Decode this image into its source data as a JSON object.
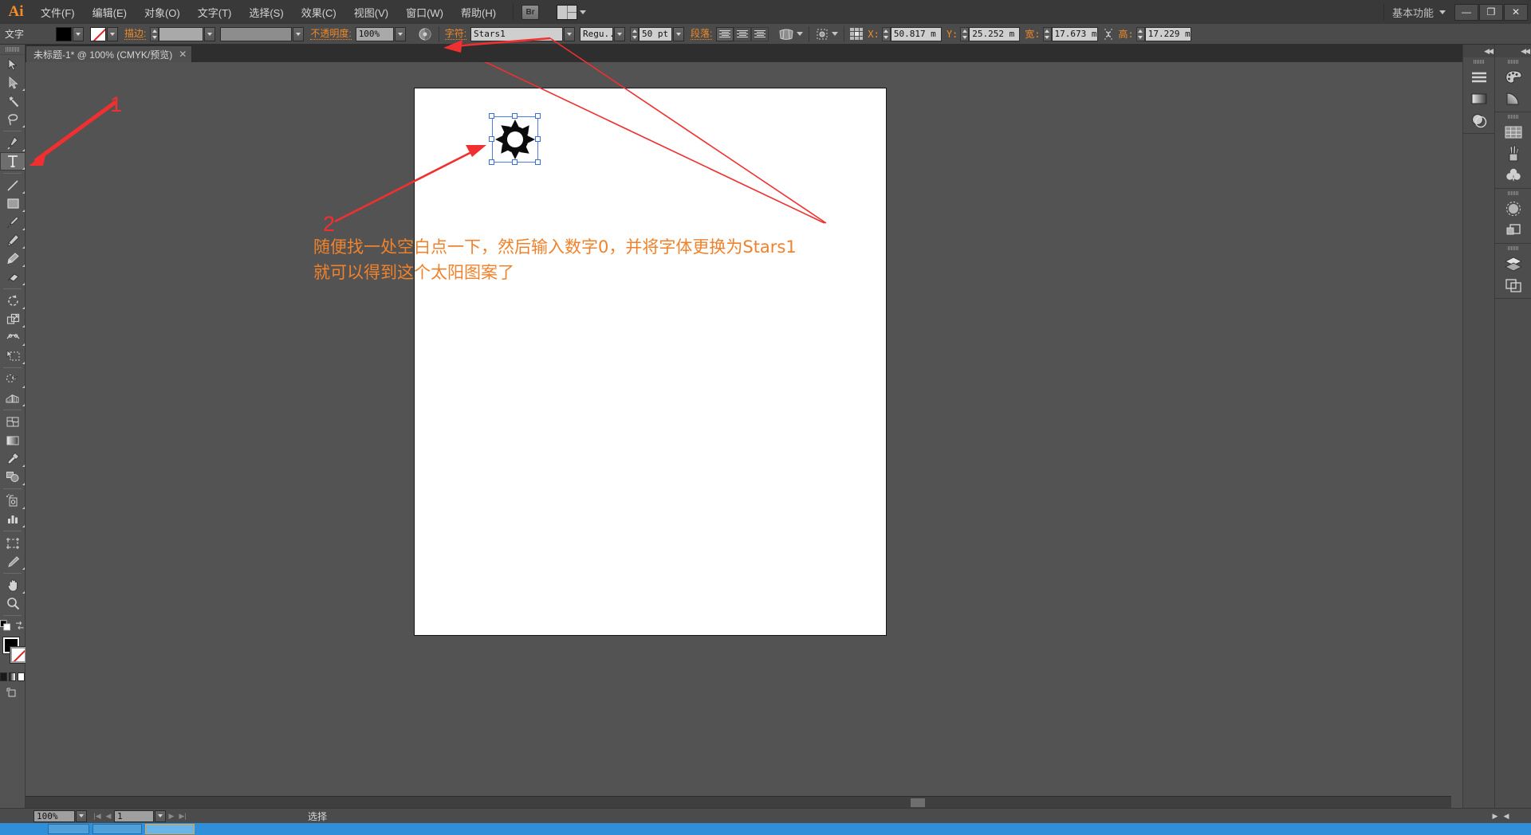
{
  "app": {
    "logo": "Ai",
    "workspace": "基本功能",
    "bridge_label": "Br"
  },
  "menubar": {
    "items": [
      {
        "label": "文件(F)"
      },
      {
        "label": "编辑(E)"
      },
      {
        "label": "对象(O)"
      },
      {
        "label": "文字(T)"
      },
      {
        "label": "选择(S)"
      },
      {
        "label": "效果(C)"
      },
      {
        "label": "视图(V)"
      },
      {
        "label": "窗口(W)"
      },
      {
        "label": "帮助(H)"
      }
    ]
  },
  "window_controls": {
    "minimize": "—",
    "restore": "❐",
    "close": "✕"
  },
  "control_bar": {
    "tool_label": "文字",
    "fill_color": "#000000",
    "stroke_color": "none",
    "stroke_label": "描边:",
    "stroke_weight": "",
    "stroke_profile": "",
    "opacity_label": "不透明度:",
    "opacity_value": "100%",
    "character_label": "字符:",
    "font_family": "Stars1",
    "font_style": "Regu...",
    "font_size": "50 pt",
    "paragraph_label": "段落:",
    "x_label": "X:",
    "x_value": "50.817 m",
    "y_label": "Y:",
    "y_value": "25.252 m",
    "w_label": "宽:",
    "w_value": "17.673 m",
    "h_label": "高:",
    "h_value": "17.229 m"
  },
  "document_tab": {
    "title": "未标题-1* @ 100% (CMYK/预览)",
    "close": "✕"
  },
  "toolbar": {
    "tools": [
      {
        "name": "selection-tool",
        "selected": false
      },
      {
        "name": "direct-selection-tool",
        "selected": false
      },
      {
        "name": "magic-wand-tool",
        "selected": false
      },
      {
        "name": "lasso-tool",
        "selected": false
      },
      {
        "name": "pen-tool",
        "selected": false
      },
      {
        "name": "type-tool",
        "selected": true
      },
      {
        "name": "line-segment-tool",
        "selected": false
      },
      {
        "name": "rectangle-tool",
        "selected": false
      },
      {
        "name": "paintbrush-tool",
        "selected": false
      },
      {
        "name": "pencil-tool",
        "selected": false
      },
      {
        "name": "blob-brush-tool",
        "selected": false
      },
      {
        "name": "eraser-tool",
        "selected": false
      },
      {
        "name": "rotate-tool",
        "selected": false
      },
      {
        "name": "scale-tool",
        "selected": false
      },
      {
        "name": "width-tool",
        "selected": false
      },
      {
        "name": "free-transform-tool",
        "selected": false
      },
      {
        "name": "shape-builder-tool",
        "selected": false
      },
      {
        "name": "perspective-grid-tool",
        "selected": false
      },
      {
        "name": "mesh-tool",
        "selected": false
      },
      {
        "name": "gradient-tool",
        "selected": false
      },
      {
        "name": "eyedropper-tool",
        "selected": false
      },
      {
        "name": "blend-tool",
        "selected": false
      },
      {
        "name": "symbol-sprayer-tool",
        "selected": false
      },
      {
        "name": "column-graph-tool",
        "selected": false
      },
      {
        "name": "artboard-tool",
        "selected": false
      },
      {
        "name": "slice-tool",
        "selected": false
      },
      {
        "name": "hand-tool",
        "selected": false
      },
      {
        "name": "zoom-tool",
        "selected": false
      }
    ]
  },
  "canvas": {
    "artboard_fill": "#ffffff",
    "object": {
      "name": "sun-glyph",
      "character": "0",
      "font": "Stars1"
    }
  },
  "annotations": {
    "marker_1": "1",
    "marker_2": "2",
    "note_line1": "随便找一处空白点一下，然后输入数字0，并将字体更换为Stars1",
    "note_line2": "就可以得到这个太阳图案了",
    "arrow_color": "#f03030",
    "note_color": "#f0822c"
  },
  "right_panels": {
    "groups": [
      {
        "icons": [
          "stroke-panel-icon",
          "gradient-panel-icon",
          "transparency-panel-icon"
        ]
      },
      {
        "icons": [
          "color-panel-icon",
          "color-guide-panel-icon"
        ]
      },
      {
        "icons": [
          "swatches-panel-icon",
          "brushes-panel-icon",
          "symbols-panel-icon"
        ]
      },
      {
        "icons": [
          "appearance-panel-icon",
          "graphic-styles-panel-icon"
        ]
      },
      {
        "icons": [
          "layers-panel-icon",
          "artboards-panel-icon"
        ]
      }
    ]
  },
  "status_bar": {
    "zoom": "100%",
    "page": "1",
    "status_text": "选择"
  }
}
